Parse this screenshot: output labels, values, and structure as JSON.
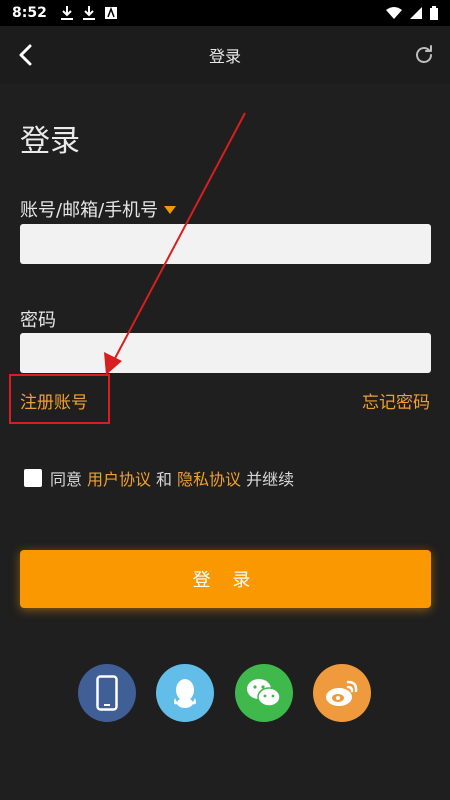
{
  "status_bar": {
    "time": "8:52"
  },
  "app_bar": {
    "title": "登录"
  },
  "page_title": "登录",
  "account": {
    "label": "账号/邮箱/手机号",
    "value": "",
    "placeholder": ""
  },
  "password": {
    "label": "密码",
    "value": "",
    "placeholder": ""
  },
  "links": {
    "register": "注册账号",
    "forgot": "忘记密码"
  },
  "agreement": {
    "prefix": "同意",
    "user_agreement": "用户协议",
    "and": "和",
    "privacy_policy": "隐私协议",
    "suffix": "并继续",
    "checked": false
  },
  "login_button": "登 录",
  "social": [
    "phone-icon",
    "qq-icon",
    "wechat-icon",
    "weibo-icon"
  ],
  "colors": {
    "accent": "#f99800",
    "link": "#f0a030",
    "background": "#1f1f1f",
    "annotation": "#d81e1e"
  }
}
